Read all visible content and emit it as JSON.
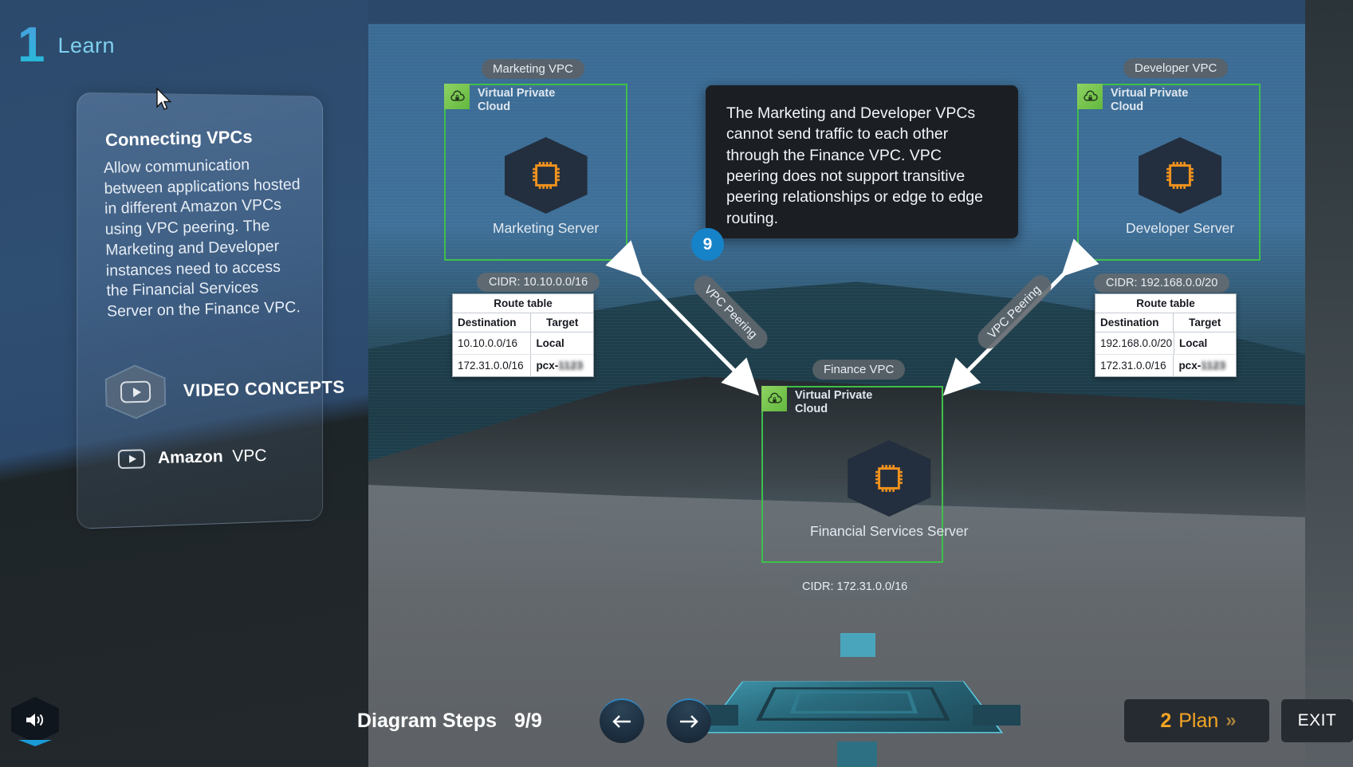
{
  "header": {
    "step_number": "1",
    "step_label": "Learn"
  },
  "info_card": {
    "title": "Connecting VPCs",
    "body": "Allow communication between applications hosted in different Amazon VPCs using VPC peering. The Marketing and Developer instances need to access the Financial Services Server on the Finance VPC.",
    "video_concepts_label": "VIDEO CONCEPTS",
    "video_item_brand": "Amazon",
    "video_item_name": "VPC"
  },
  "callout": {
    "text": "The Marketing and Developer VPCs cannot send traffic to each other through the Finance VPC. VPC peering does not support transitive peering relationships or edge to edge routing.",
    "step_badge": "9"
  },
  "diagram": {
    "vpc_inner_label": "Virtual Private Cloud",
    "marketing": {
      "badge": "Marketing VPC",
      "server": "Marketing Server",
      "cidr": "CIDR: 10.10.0.0/16",
      "route_table": {
        "title": "Route table",
        "columns": [
          "Destination",
          "Target"
        ],
        "rows": [
          [
            "10.10.0.0/16",
            "Local"
          ],
          [
            "172.31.0.0/16",
            "pcx-"
          ]
        ]
      }
    },
    "developer": {
      "badge": "Developer VPC",
      "server": "Developer Server",
      "cidr": "CIDR: 192.168.0.0/20",
      "route_table": {
        "title": "Route table",
        "columns": [
          "Destination",
          "Target"
        ],
        "rows": [
          [
            "192.168.0.0/20",
            "Local"
          ],
          [
            "172.31.0.0/16",
            "pcx-"
          ]
        ]
      }
    },
    "finance": {
      "badge": "Finance VPC",
      "server": "Financial Services Server",
      "cidr": "CIDR: 172.31.0.0/16"
    },
    "peering_left_label": "VPC Peering",
    "peering_right_label": "VPC Peering"
  },
  "footer": {
    "steps_label": "Diagram Steps",
    "steps_count": "9/9",
    "prev_icon": "arrow-left-icon",
    "next_icon": "arrow-right-icon",
    "plan_number": "2",
    "plan_label": "Plan",
    "plan_chevron": "»",
    "exit_label": "EXIT",
    "sound_icon": "speaker-icon"
  },
  "colors": {
    "accent_green": "#3fbf4a",
    "accent_orange": "#f5a623",
    "accent_blue": "#1683c8",
    "aws_navy": "#232f3e"
  }
}
